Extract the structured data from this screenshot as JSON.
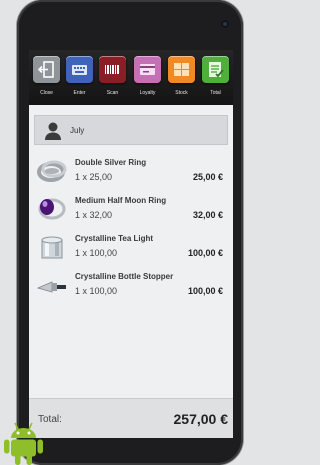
{
  "toolbar": {
    "buttons": [
      {
        "label": "Close",
        "icon": "exit-icon",
        "color": "#8f9498"
      },
      {
        "label": "Enter",
        "icon": "keyboard-icon",
        "color": "#3f63b8"
      },
      {
        "label": "Scan",
        "icon": "barcode-icon",
        "color": "#8a1d25"
      },
      {
        "label": "Loyalty",
        "icon": "card-icon",
        "color": "#c56fb7"
      },
      {
        "label": "Stock",
        "icon": "warehouse-icon",
        "color": "#f08a25"
      },
      {
        "label": "Total",
        "icon": "checklist-icon",
        "color": "#4fae3c"
      }
    ]
  },
  "customer": {
    "name": "July",
    "icon": "person-icon"
  },
  "cart": {
    "items": [
      {
        "name": "Double Silver Ring",
        "qty_price": "1 x 25,00",
        "total": "25,00 €",
        "icon": "silver-ring-icon"
      },
      {
        "name": "Medium Half Moon Ring",
        "qty_price": "1 x 32,00",
        "total": "32,00 €",
        "icon": "gem-ring-icon"
      },
      {
        "name": "Crystalline Tea Light",
        "qty_price": "1 x 100,00",
        "total": "100,00 €",
        "icon": "tea-light-icon"
      },
      {
        "name": "Crystalline Bottle Stopper",
        "qty_price": "1 x 100,00",
        "total": "100,00 €",
        "icon": "bottle-stopper-icon"
      }
    ]
  },
  "summary": {
    "label": "Total:",
    "value": "257,00 €"
  }
}
